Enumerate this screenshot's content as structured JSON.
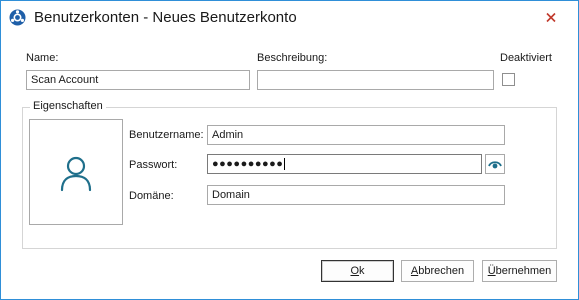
{
  "window": {
    "title": "Benutzerkonten - Neues Benutzerkonto",
    "accent_color": "#2f8fd8",
    "close_icon": "close-icon",
    "close_icon_color": "#c0392b",
    "app_icon": "app-logo-icon"
  },
  "account": {
    "name_label": "Name:",
    "name_value": "Scan Account",
    "description_label": "Beschreibung:",
    "description_value": "",
    "deactivated_label": "Deaktiviert",
    "deactivated_checked": false
  },
  "properties": {
    "group_label": "Eigenschaften",
    "avatar_icon": "user-icon",
    "avatar_color": "#1f6f8b",
    "username_label": "Benutzername:",
    "username_value": "Admin",
    "password_label": "Passwort:",
    "password_masked": "●●●●●●●●●●",
    "show_password_icon": "eye-icon",
    "domain_label": "Domäne:",
    "domain_value": "Domain"
  },
  "buttons": {
    "ok": {
      "mnemonic": "O",
      "rest": "k"
    },
    "cancel": {
      "mnemonic": "A",
      "rest": "bbrechen"
    },
    "apply": {
      "mnemonic": "Ü",
      "rest": "bernehmen"
    }
  }
}
